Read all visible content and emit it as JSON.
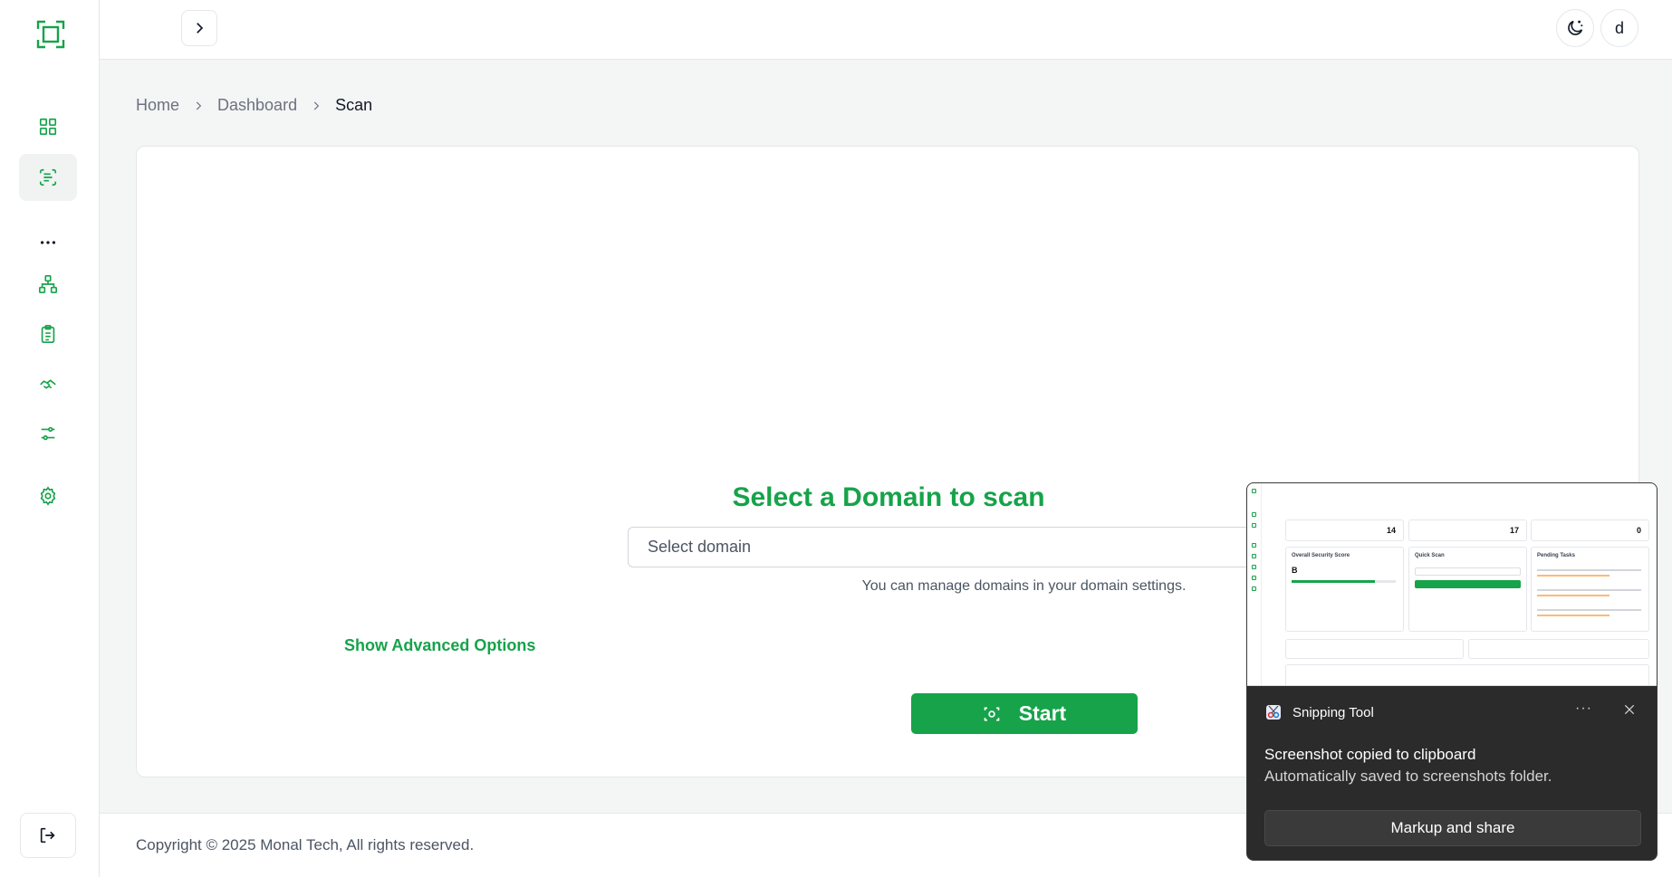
{
  "header": {
    "theme_toggle_icon": "moon-sparkle-icon",
    "avatar_initial": "d"
  },
  "sidebar": {
    "items": [
      {
        "name": "dashboard",
        "icon": "grid-icon"
      },
      {
        "name": "scan",
        "icon": "scan-text-icon",
        "active": true
      },
      {
        "name": "more",
        "icon": "more-horizontal-icon"
      },
      {
        "name": "network",
        "icon": "network-icon"
      },
      {
        "name": "reports",
        "icon": "clipboard-icon"
      },
      {
        "name": "handshake",
        "icon": "handshake-icon"
      },
      {
        "name": "filters",
        "icon": "sliders-icon"
      },
      {
        "name": "settings",
        "icon": "gear-icon"
      }
    ],
    "logout_icon": "logout-icon"
  },
  "breadcrumb": {
    "items": [
      "Home",
      "Dashboard",
      "Scan"
    ]
  },
  "scan": {
    "title": "Select a Domain to scan",
    "select_placeholder": "Select domain",
    "helper": "You can manage domains in your domain settings.",
    "advanced_link": "Show Advanced Options",
    "start_label": "Start"
  },
  "footer": {
    "copyright": "Copyright © 2025 Monal Tech, All rights reserved."
  },
  "toast": {
    "app_name": "Snipping Tool",
    "more": "···",
    "title": "Screenshot copied to clipboard",
    "subtitle": "Automatically saved to screenshots folder.",
    "button": "Markup and share",
    "preview": {
      "stats": [
        "14",
        "17",
        "0"
      ],
      "grade": "B",
      "card_titles": [
        "Overall Security Score",
        "Quick Scan",
        "Pending Tasks"
      ]
    }
  },
  "colors": {
    "brand": "#16a34a",
    "toast_bg": "#2b2b2b"
  }
}
